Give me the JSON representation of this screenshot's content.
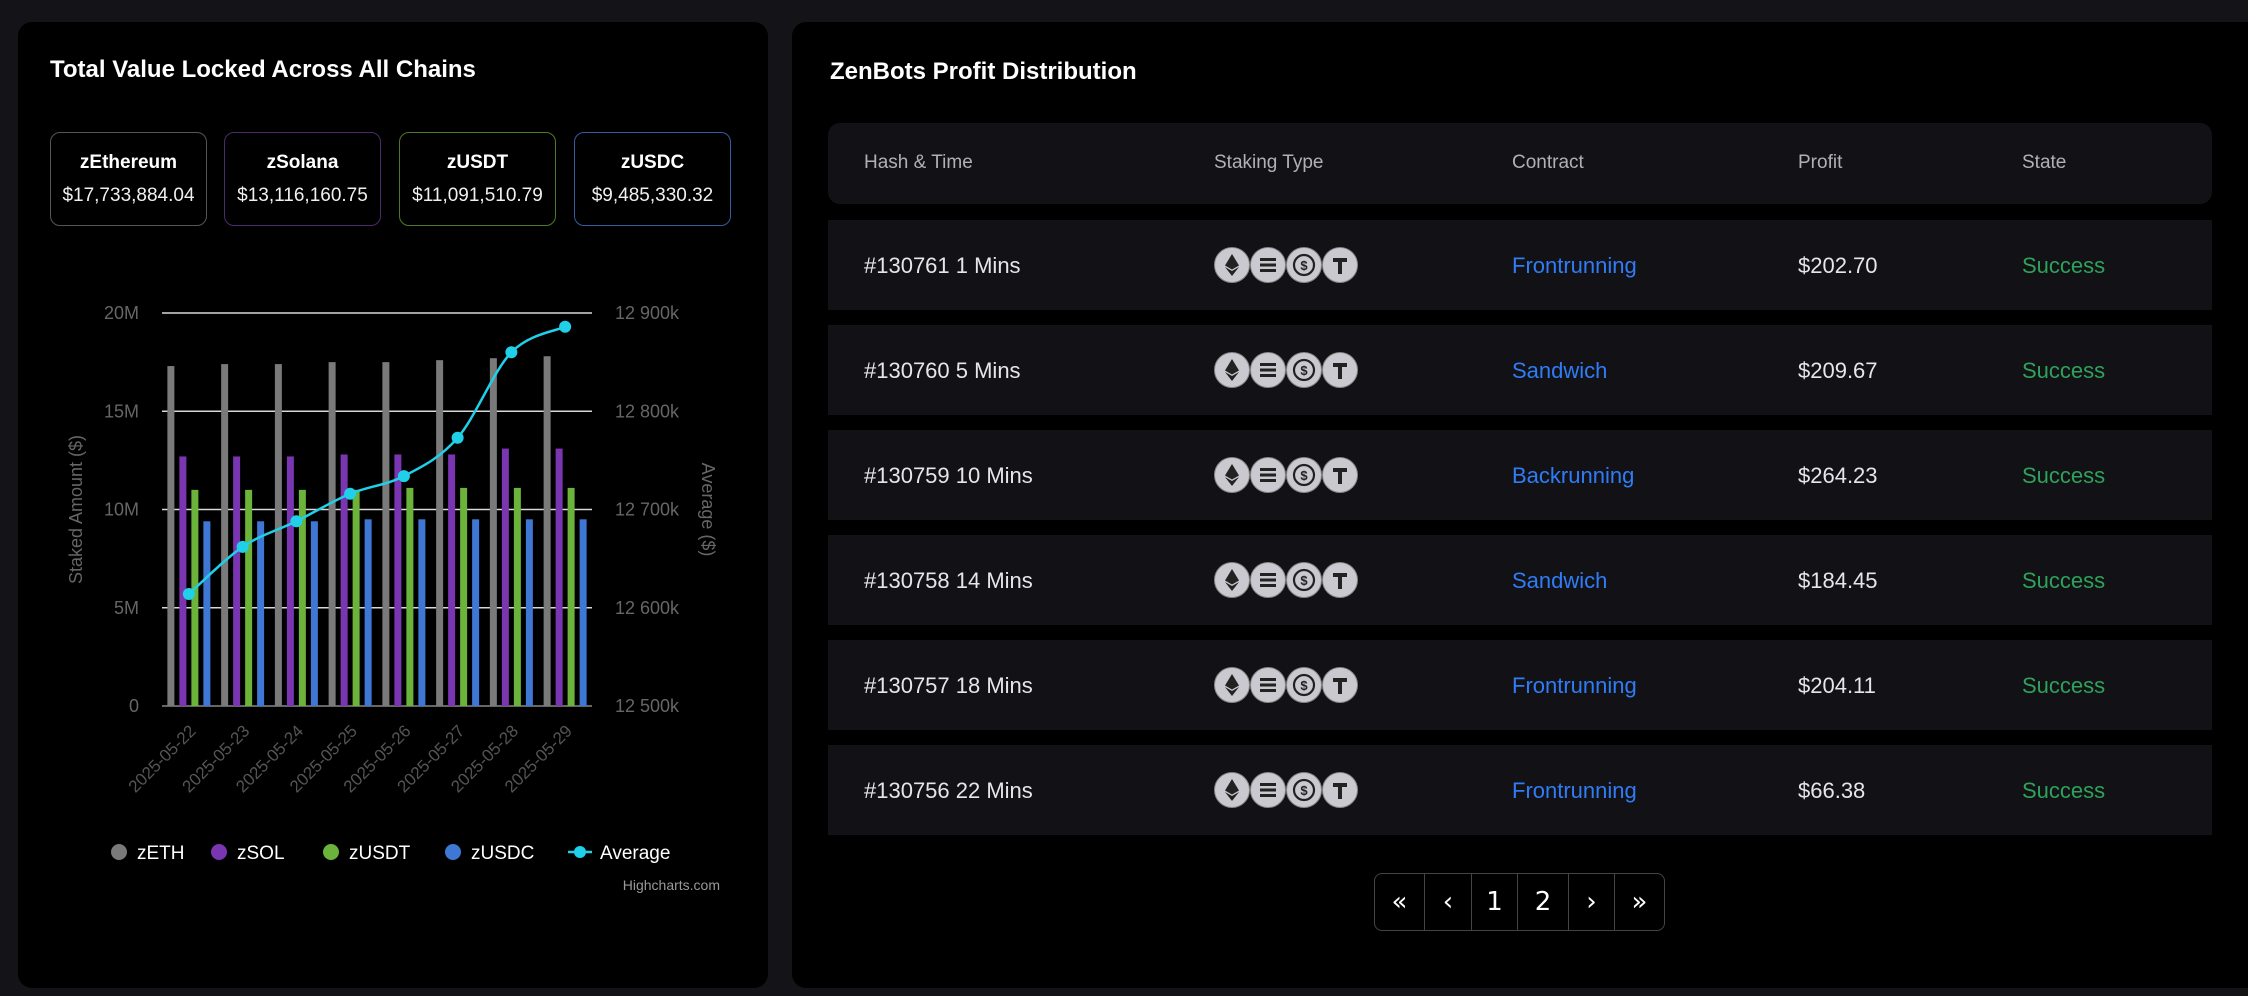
{
  "tvl": {
    "title": "Total Value Locked Across All Chains",
    "cards": [
      {
        "name": "zEthereum",
        "value": "$17,733,884.04",
        "color": "#555555"
      },
      {
        "name": "zSolana",
        "value": "$13,116,160.75",
        "color": "#5b2c83"
      },
      {
        "name": "zUSDT",
        "value": "$11,091,510.79",
        "color": "#5a8a2a"
      },
      {
        "name": "zUSDC",
        "value": "$9,485,330.32",
        "color": "#3a5fa8"
      }
    ]
  },
  "chart_data": {
    "type": "bar",
    "categories": [
      "2025-05-22",
      "2025-05-23",
      "2025-05-24",
      "2025-05-25",
      "2025-05-26",
      "2025-05-27",
      "2025-05-28",
      "2025-05-29"
    ],
    "series": [
      {
        "name": "zETH",
        "color": "#7a7a7a",
        "values": [
          17.3,
          17.4,
          17.4,
          17.5,
          17.5,
          17.6,
          17.7,
          17.8
        ]
      },
      {
        "name": "zSOL",
        "color": "#7a35b0",
        "values": [
          12.7,
          12.7,
          12.7,
          12.8,
          12.8,
          12.8,
          13.1,
          13.1
        ]
      },
      {
        "name": "zUSDT",
        "color": "#6bb33a",
        "values": [
          11.0,
          11.0,
          11.0,
          11.0,
          11.1,
          11.1,
          11.1,
          11.1
        ]
      },
      {
        "name": "zUSDC",
        "color": "#3f78d4",
        "values": [
          9.4,
          9.4,
          9.4,
          9.5,
          9.5,
          9.5,
          9.5,
          9.5
        ]
      },
      {
        "name": "Average",
        "color": "#1fd0e8",
        "type": "line",
        "axis": "right",
        "values": [
          12614,
          12662,
          12688,
          12716,
          12734,
          12773,
          12860,
          12886
        ]
      }
    ],
    "ylabel": "Staked Amount ($)",
    "y2label": "Average ($)",
    "ylim": [
      0,
      20
    ],
    "y2lim": [
      12500,
      12900
    ],
    "yticks": [
      "0",
      "5M",
      "10M",
      "15M",
      "20M"
    ],
    "y2ticks": [
      "12 500k",
      "12 600k",
      "12 700k",
      "12 800k",
      "12 900k"
    ],
    "legend": "bottom",
    "credits": "Highcharts.com"
  },
  "profit": {
    "title": "ZenBots Profit Distribution",
    "columns": [
      "Hash & Time",
      "Staking Type",
      "Contract",
      "Profit",
      "State"
    ],
    "coin_icons": [
      "ethereum-icon",
      "solana-icon",
      "usdc-icon",
      "tether-icon"
    ],
    "rows": [
      {
        "hash": "#130761 1 Mins",
        "contract": "Frontrunning",
        "profit": "$202.70",
        "state": "Success"
      },
      {
        "hash": "#130760 5 Mins",
        "contract": "Sandwich",
        "profit": "$209.67",
        "state": "Success"
      },
      {
        "hash": "#130759 10 Mins",
        "contract": "Backrunning",
        "profit": "$264.23",
        "state": "Success"
      },
      {
        "hash": "#130758 14 Mins",
        "contract": "Sandwich",
        "profit": "$184.45",
        "state": "Success"
      },
      {
        "hash": "#130757 18 Mins",
        "contract": "Frontrunning",
        "profit": "$204.11",
        "state": "Success"
      },
      {
        "hash": "#130756 22 Mins",
        "contract": "Frontrunning",
        "profit": "$66.38",
        "state": "Success"
      }
    ],
    "pagination": [
      "«",
      "‹",
      "1",
      "2",
      "›",
      "»"
    ]
  }
}
